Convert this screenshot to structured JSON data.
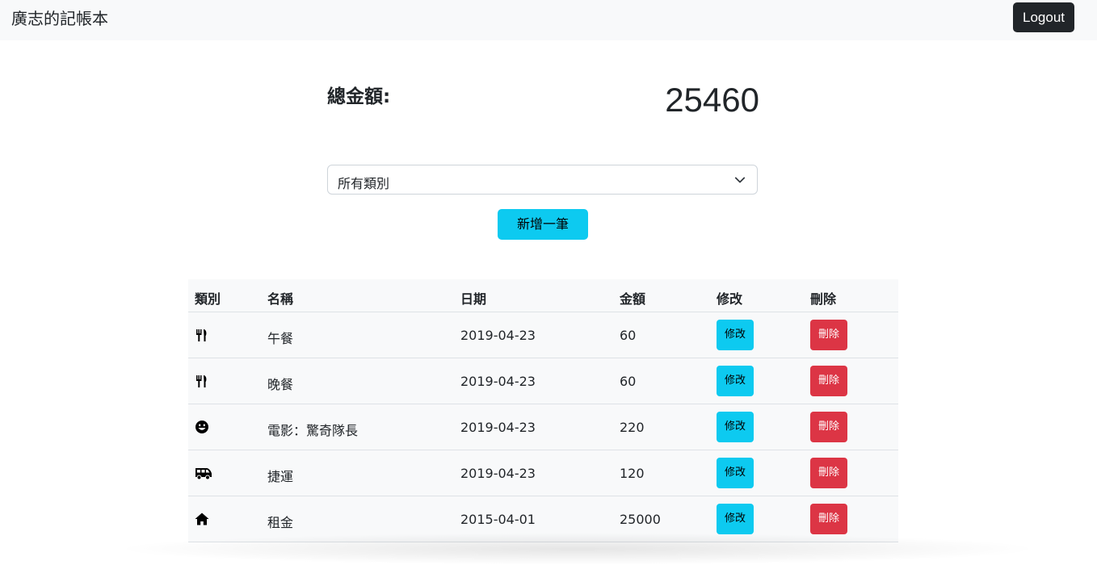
{
  "app": {
    "brand": "廣志的記帳本",
    "logout_label": "Logout"
  },
  "summary": {
    "total_label": "總金額:",
    "total_value": "25460"
  },
  "filter": {
    "selected": "所有類別"
  },
  "add_button_label": "新增一筆",
  "table": {
    "headers": [
      "類別",
      "名稱",
      "日期",
      "金額",
      "修改",
      "刪除"
    ],
    "rows": [
      {
        "category_icon": "utensils-icon",
        "name": "午餐",
        "date": "2019-04-23",
        "amount": "60",
        "edit": "修改",
        "delete": "刪除"
      },
      {
        "category_icon": "utensils-icon",
        "name": "晚餐",
        "date": "2019-04-23",
        "amount": "60",
        "edit": "修改",
        "delete": "刪除"
      },
      {
        "category_icon": "smile-icon",
        "name": "電影：驚奇隊長",
        "date": "2019-04-23",
        "amount": "220",
        "edit": "修改",
        "delete": "刪除"
      },
      {
        "category_icon": "shuttle-van-icon",
        "name": "捷運",
        "date": "2019-04-23",
        "amount": "120",
        "edit": "修改",
        "delete": "刪除"
      },
      {
        "category_icon": "home-icon",
        "name": "租金",
        "date": "2015-04-01",
        "amount": "25000",
        "edit": "修改",
        "delete": "刪除"
      }
    ]
  },
  "colors": {
    "info": "#0dcaf0",
    "danger": "#dc3545",
    "dark": "#212529",
    "light": "#f8f9fa"
  }
}
